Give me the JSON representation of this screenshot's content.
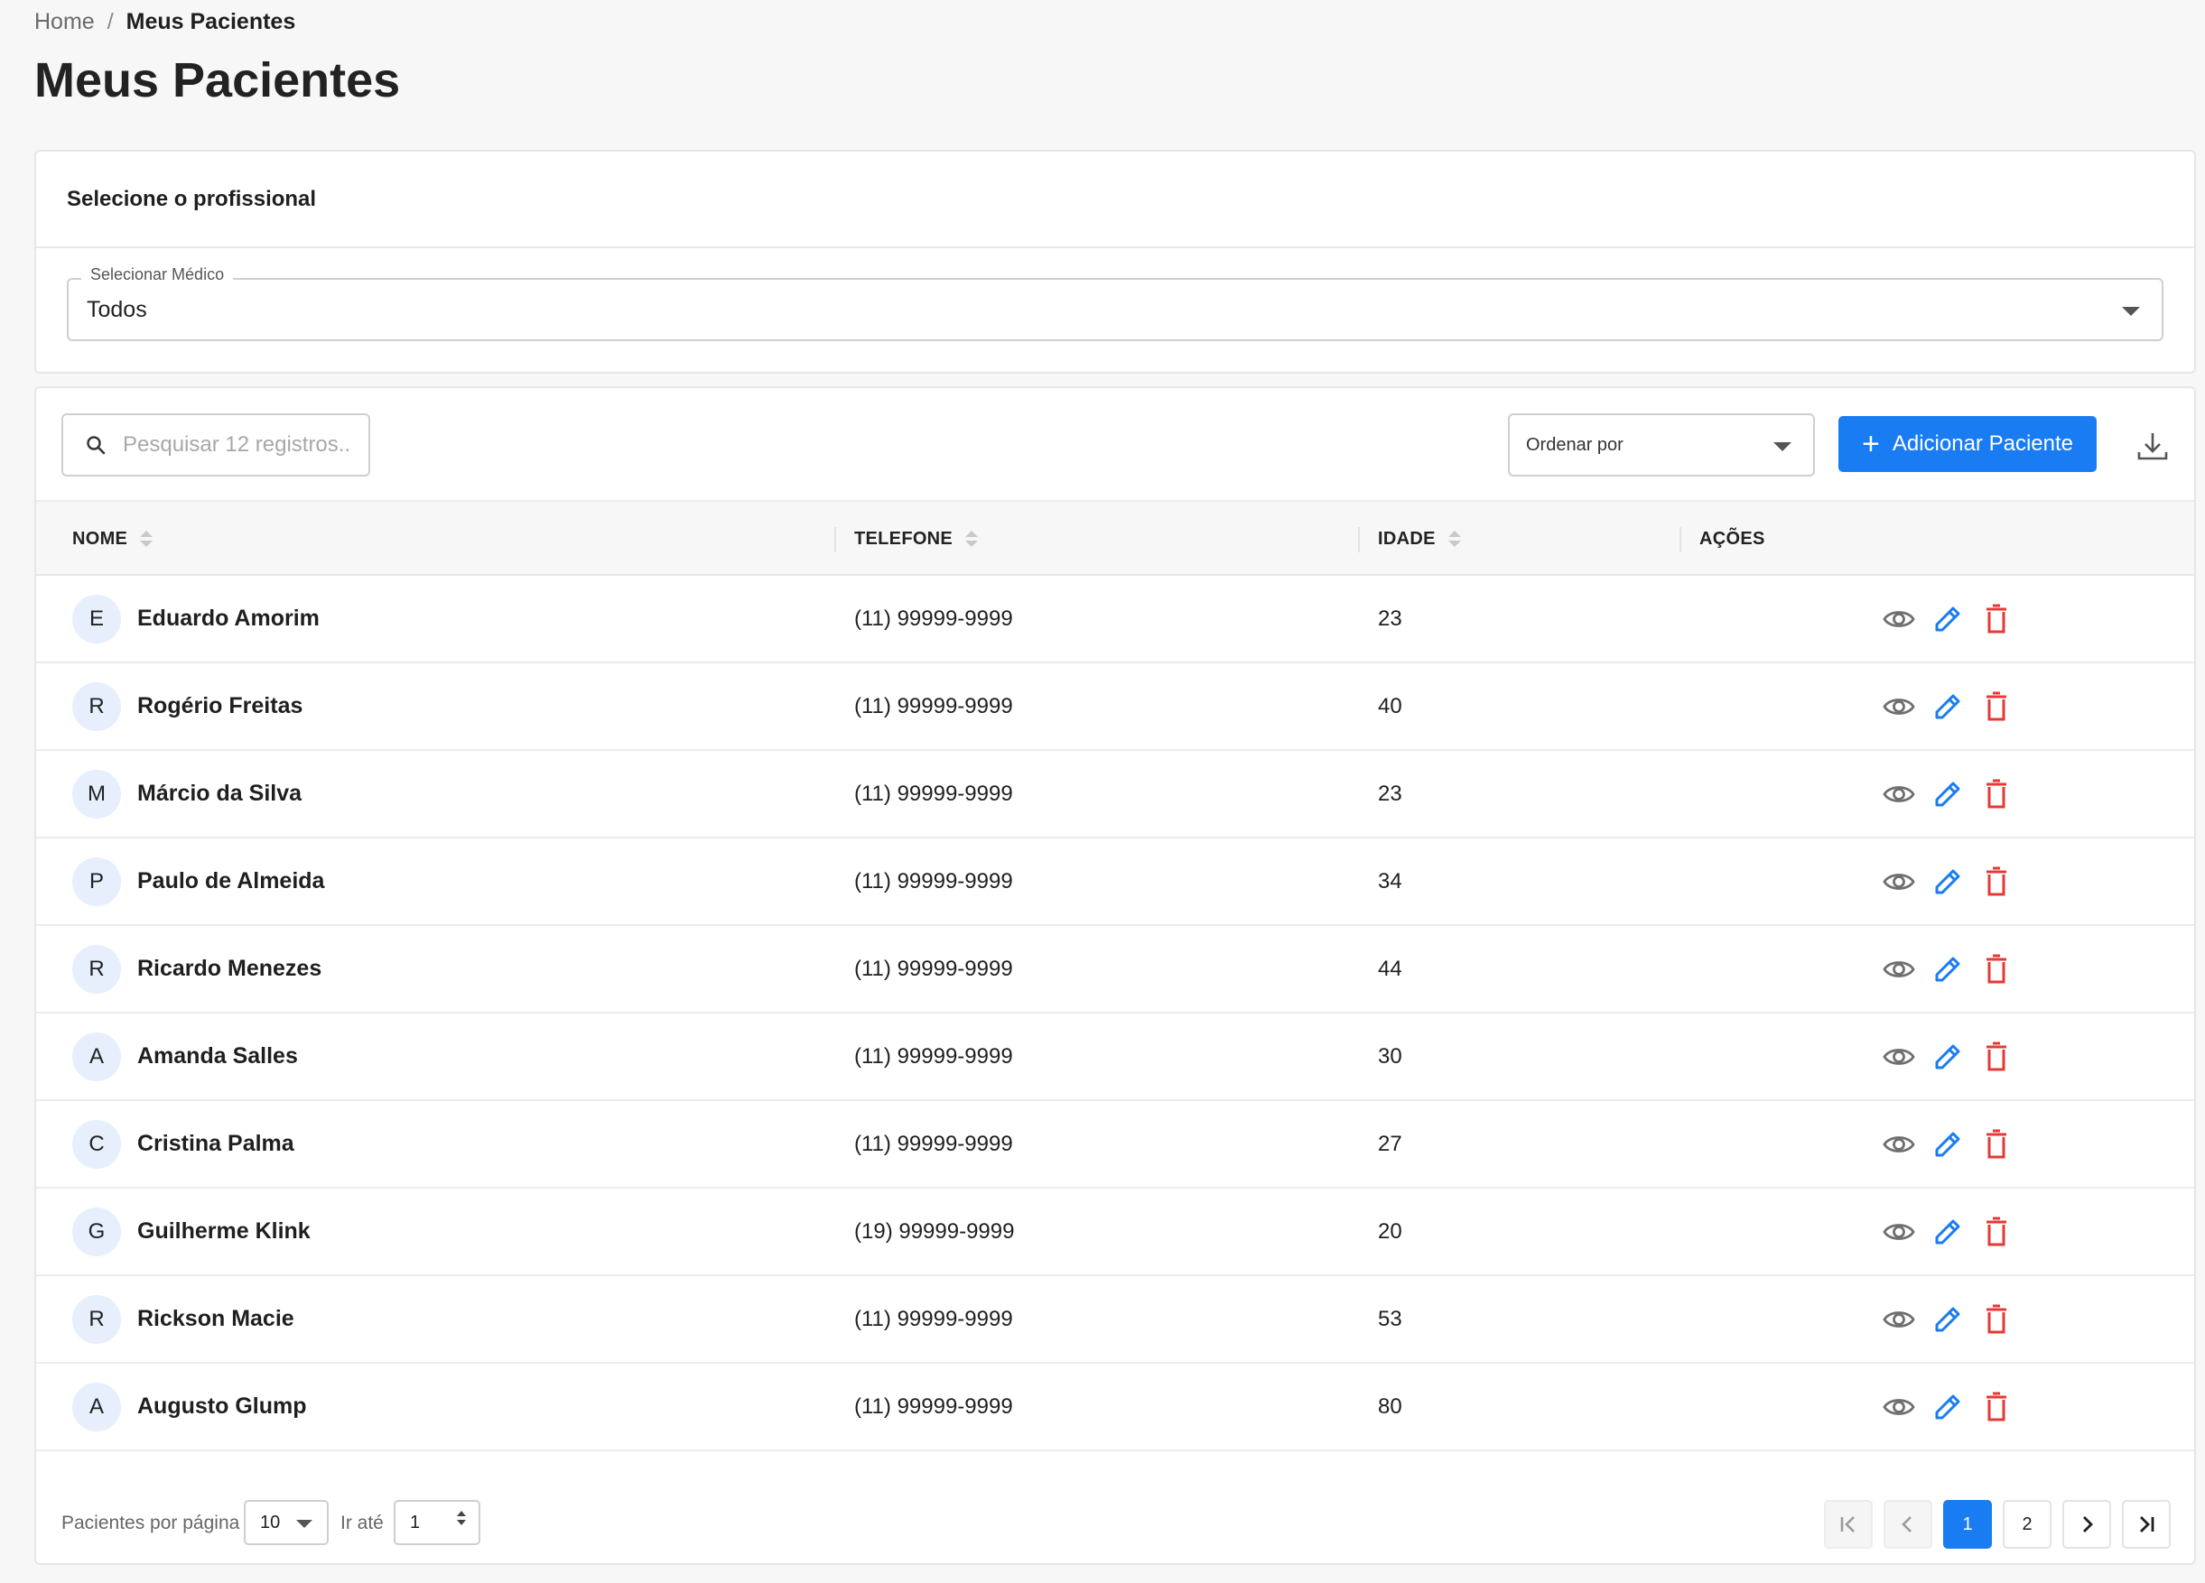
{
  "breadcrumb": {
    "home": "Home",
    "separator": "/",
    "current": "Meus Pacientes"
  },
  "page_title": "Meus Pacientes",
  "professional_card": {
    "title": "Selecione o profissional",
    "select_label": "Selecionar Médico",
    "select_value": "Todos"
  },
  "toolbar": {
    "search_placeholder": "Pesquisar 12 registros..",
    "order_label": "Ordenar por",
    "add_button": "Adicionar Paciente",
    "plus": "+"
  },
  "columns": {
    "name": "NOME",
    "phone": "TELEFONE",
    "age": "IDADE",
    "actions": "AÇÕES"
  },
  "rows": [
    {
      "initial": "E",
      "name": "Eduardo Amorim",
      "phone": "(11) 99999-9999",
      "age": "23"
    },
    {
      "initial": "R",
      "name": "Rogério Freitas",
      "phone": "(11) 99999-9999",
      "age": "40"
    },
    {
      "initial": "M",
      "name": "Márcio da Silva",
      "phone": "(11) 99999-9999",
      "age": "23"
    },
    {
      "initial": "P",
      "name": "Paulo de Almeida",
      "phone": "(11) 99999-9999",
      "age": "34"
    },
    {
      "initial": "R",
      "name": "Ricardo Menezes",
      "phone": "(11) 99999-9999",
      "age": "44"
    },
    {
      "initial": "A",
      "name": "Amanda Salles",
      "phone": "(11) 99999-9999",
      "age": "30"
    },
    {
      "initial": "C",
      "name": "Cristina Palma",
      "phone": "(11) 99999-9999",
      "age": "27"
    },
    {
      "initial": "G",
      "name": "Guilherme Klink",
      "phone": "(19) 99999-9999",
      "age": "20"
    },
    {
      "initial": "R",
      "name": "Rickson Macie",
      "phone": "(11) 99999-9999",
      "age": "53"
    },
    {
      "initial": "A",
      "name": "Augusto Glump",
      "phone": "(11) 99999-9999",
      "age": "80"
    }
  ],
  "footer": {
    "per_page_label": "Pacientes por página",
    "per_page_value": "10",
    "goto_label": "Ir até",
    "goto_value": "1",
    "pages": [
      "1",
      "2"
    ],
    "current_page": "1"
  },
  "icons": {
    "search": "search-icon",
    "dropdown": "caret-down-icon",
    "download": "download-icon",
    "sort": "sort-icon",
    "view": "eye-icon",
    "edit": "pencil-icon",
    "delete": "trash-icon",
    "first": "first-page-icon",
    "prev": "chevron-left-icon",
    "next": "chevron-right-icon",
    "last": "last-page-icon"
  },
  "colors": {
    "primary": "#1a7cf3",
    "danger": "#e53935",
    "view_icon": "#6f6f6f",
    "avatar_bg": "#e6effb"
  }
}
